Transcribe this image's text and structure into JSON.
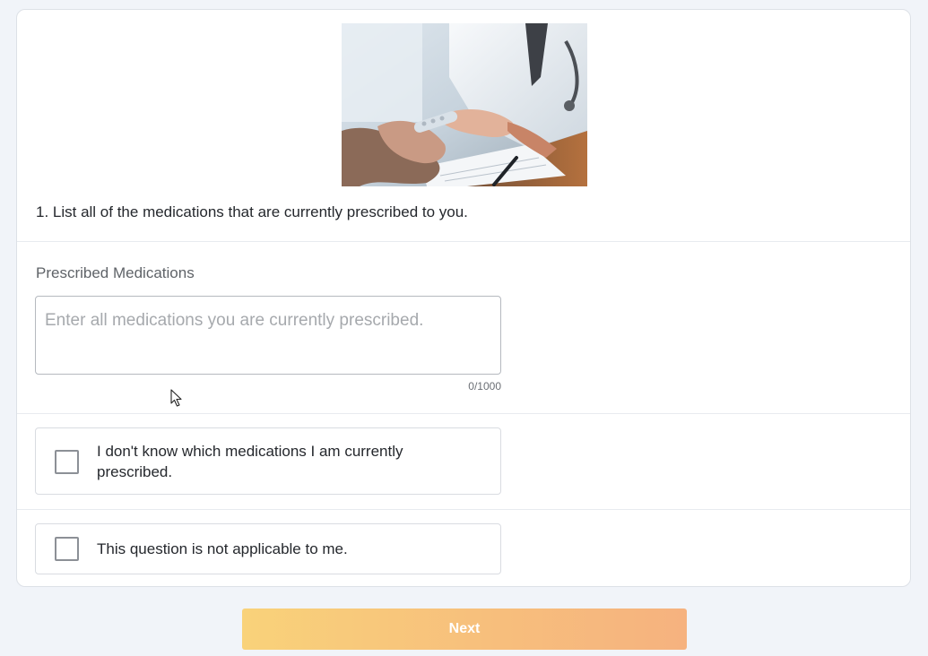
{
  "image": {
    "alt": "doctor-handing-medication-photo"
  },
  "question": {
    "text": "1. List all of the medications that are currently prescribed to you."
  },
  "medications_field": {
    "label": "Prescribed Medications",
    "value": "",
    "placeholder": "Enter all medications you are currently prescribed.",
    "counter": "0/1000"
  },
  "options": [
    {
      "label": "I don't know which medications I am currently prescribed.",
      "checked": false
    },
    {
      "label": "This question is not applicable to me.",
      "checked": false
    }
  ],
  "next_button": {
    "label": "Next"
  },
  "colors": {
    "page_background": "#f1f4f9",
    "button_gradient_start": "#f9d27a",
    "button_gradient_end": "#f6b27f",
    "text": "#25282d"
  }
}
